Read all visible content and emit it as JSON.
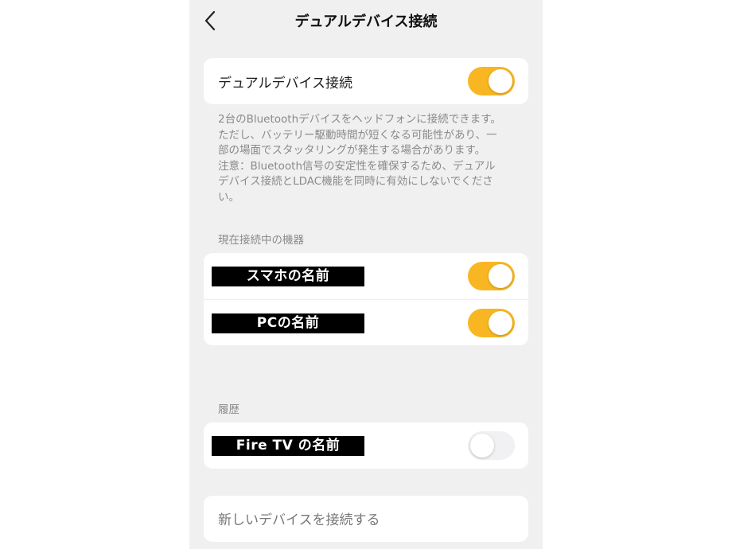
{
  "header": {
    "title": "デュアルデバイス接続",
    "back_icon": "chevron-left-icon"
  },
  "dual_connect": {
    "label": "デュアルデバイス接続",
    "enabled": true,
    "description": "2台のBluetoothデバイスをヘッドフォンに接続できます。\nただし、バッテリー駆動時間が短くなる可能性があり、一\n部の場面でスタッタリングが発生する場合があります。\n注意：Bluetooth信号の安定性を確保するため、デュアル\nデバイス接続とLDAC機能を同時に有効にしないでくださ\nい。"
  },
  "connected": {
    "section_label": "現在接続中の機器",
    "devices": [
      {
        "name": "スマホの名前",
        "enabled": true
      },
      {
        "name": "PCの名前",
        "enabled": true
      }
    ]
  },
  "history": {
    "section_label": "履歴",
    "devices": [
      {
        "name": "Fire TV の名前",
        "enabled": false
      }
    ]
  },
  "new_device": {
    "label": "新しいデバイスを接続する"
  },
  "colors": {
    "accent": "#f8b722",
    "background": "#f0f0f0",
    "card": "#ffffff",
    "muted_text": "#8a8a8a"
  }
}
